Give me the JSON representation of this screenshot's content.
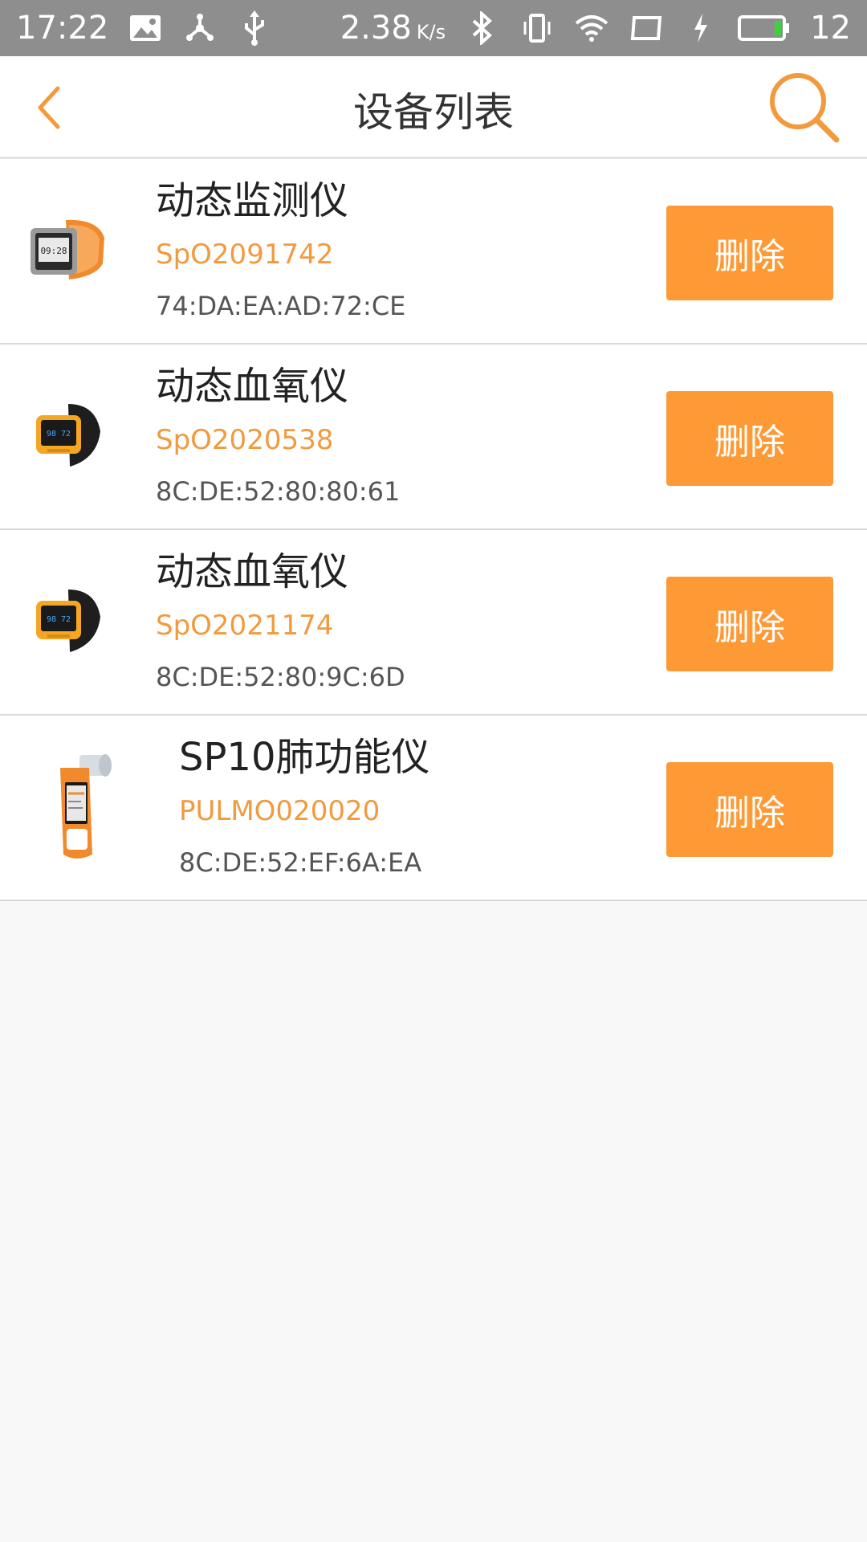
{
  "status_bar": {
    "time": "17:22",
    "speed_value": "2.38",
    "speed_unit": "K/s",
    "battery_percent": "12",
    "icons": [
      "image-icon",
      "share-network-icon",
      "usb-icon",
      "bluetooth-icon",
      "vibrate-icon",
      "wifi-icon",
      "screen-icon",
      "charging-icon",
      "battery-icon"
    ]
  },
  "header": {
    "title": "设备列表",
    "back_icon": "chevron-left-icon",
    "search_icon": "search-icon",
    "accent_color": "#f19a3e"
  },
  "devices": [
    {
      "name": "动态监测仪",
      "serial": "SpO2091742",
      "mac": "74:DA:EA:AD:72:CE",
      "delete_label": "删除",
      "image": "orange-smartwatch-image"
    },
    {
      "name": "动态血氧仪",
      "serial": "SpO2020538",
      "mac": "8C:DE:52:80:80:61",
      "delete_label": "删除",
      "image": "wrist-oximeter-image"
    },
    {
      "name": "动态血氧仪",
      "serial": "SpO2021174",
      "mac": "8C:DE:52:80:9C:6D",
      "delete_label": "删除",
      "image": "wrist-oximeter-image"
    },
    {
      "name": "SP10肺功能仪",
      "serial": "PULMO020020",
      "mac": "8C:DE:52:EF:6A:EA",
      "delete_label": "删除",
      "image": "spirometer-image"
    }
  ]
}
